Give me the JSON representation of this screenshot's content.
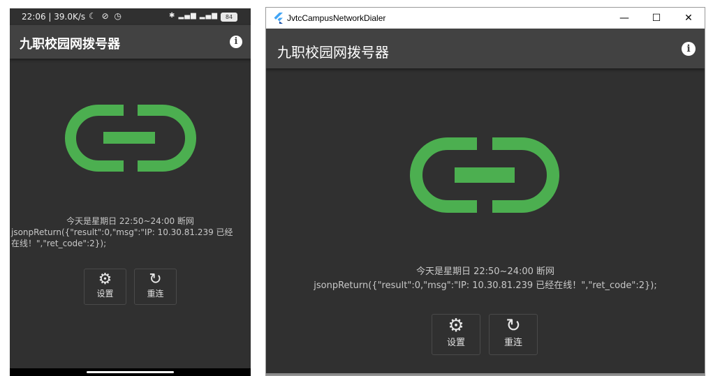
{
  "phone": {
    "status_bar": {
      "time": "22:06",
      "speed": "39.0K/s",
      "left_icons": "☾ ⊘ ◷",
      "right_icons": "✱ ▂▄▆ ▂▄▆ ◠",
      "battery": "84"
    },
    "appbar": {
      "title": "九职校园网拨号器",
      "info_icon": "i"
    },
    "status": {
      "schedule": "今天是星期日   22:50~24:00 断网",
      "response": "jsonpReturn({\"result\":0,\"msg\":\"IP: 10.30.81.239 已经在线！\",\"ret_code\":2});"
    },
    "buttons": [
      {
        "icon": "gear-icon",
        "glyph": "⚙",
        "label": "设置"
      },
      {
        "icon": "refresh-icon",
        "glyph": "↻",
        "label": "重连"
      }
    ]
  },
  "window": {
    "title": "JvtcCampusNetworkDialer",
    "controls": {
      "minimize": "—",
      "maximize": "☐",
      "close": "✕"
    },
    "appbar": {
      "title": "九职校园网拨号器",
      "info_icon": "i"
    },
    "status": {
      "schedule": "今天是星期日   22:50~24:00 断网",
      "response": "jsonpReturn({\"result\":0,\"msg\":\"IP: 10.30.81.239 已经在线！\",\"ret_code\":2});"
    },
    "buttons": [
      {
        "icon": "gear-icon",
        "glyph": "⚙",
        "label": "设置"
      },
      {
        "icon": "refresh-icon",
        "glyph": "↻",
        "label": "重连"
      }
    ]
  },
  "colors": {
    "background": "#303030",
    "appbar": "#424242",
    "link_icon": "#4CAF50",
    "text": "#c8c8c8"
  }
}
